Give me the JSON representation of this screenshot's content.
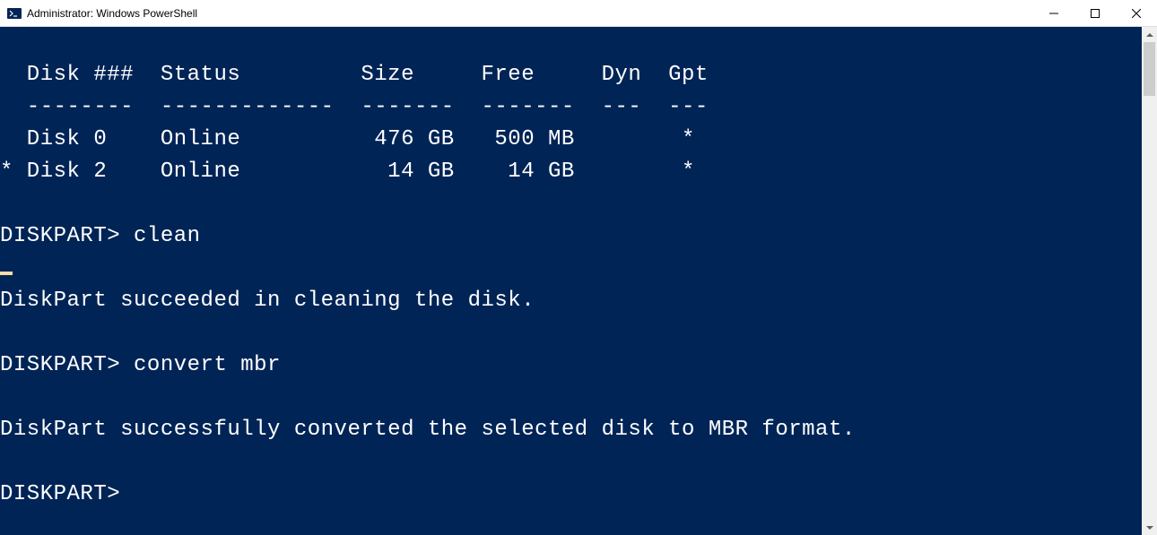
{
  "window": {
    "title": "Administrator: Windows PowerShell"
  },
  "terminal": {
    "header_line": "  Disk ###  Status         Size     Free     Dyn  Gpt",
    "divider_line": "  --------  -------------  -------  -------  ---  ---",
    "disk_rows": [
      "  Disk 0    Online          476 GB   500 MB        *",
      "* Disk 2    Online           14 GB    14 GB        *"
    ],
    "prompt1": "DISKPART> ",
    "cmd1": "clean",
    "msg1": "DiskPart succeeded in cleaning the disk.",
    "prompt2": "DISKPART> ",
    "cmd2": "convert mbr",
    "msg2": "DiskPart successfully converted the selected disk to MBR format.",
    "prompt3": "DISKPART> "
  }
}
